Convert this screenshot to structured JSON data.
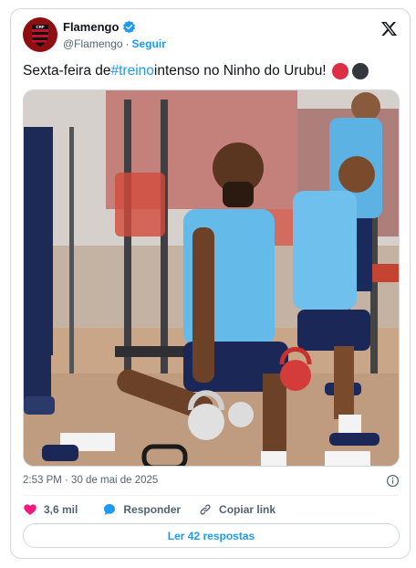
{
  "author": {
    "name": "Flamengo",
    "handle": "@Flamengo",
    "separator": "·",
    "follow_label": "Seguir",
    "verified": true
  },
  "tweet": {
    "text_before": "Sexta-feira de ",
    "hashtag": "#treino",
    "text_after": " intenso no Ninho do Urubu!",
    "emoji_dots": [
      "red-circle",
      "black-circle"
    ]
  },
  "media": {
    "description": "photo",
    "icon": "photo"
  },
  "meta": {
    "timestamp": "2:53 PM · 30 de mai de 2025",
    "info_icon": "info-icon"
  },
  "actions": {
    "like_count": "3,6 mil",
    "reply_label": "Responder",
    "copy_label": "Copiar link"
  },
  "replies_button": "Ler 42 respostas",
  "colors": {
    "accent": "#1d9bf0",
    "like": "#f91880",
    "flamengo_red": "#c8102e",
    "text_secondary": "#536471"
  }
}
